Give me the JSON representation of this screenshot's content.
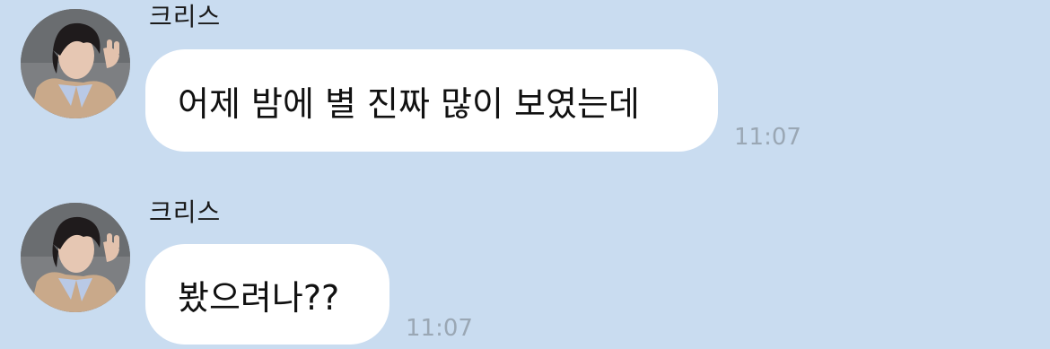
{
  "colors": {
    "background": "#c9dcf0",
    "bubble": "#ffffff",
    "timestamp": "#9aa7b4",
    "text": "#111111"
  },
  "messages": [
    {
      "sender": "크리스",
      "avatar_icon": "profile-photo",
      "text": "어제 밤에 별 진짜 많이 보였는데",
      "time": "11:07"
    },
    {
      "sender": "크리스",
      "avatar_icon": "profile-photo",
      "text": "봤으려나??",
      "time": "11:07"
    }
  ]
}
